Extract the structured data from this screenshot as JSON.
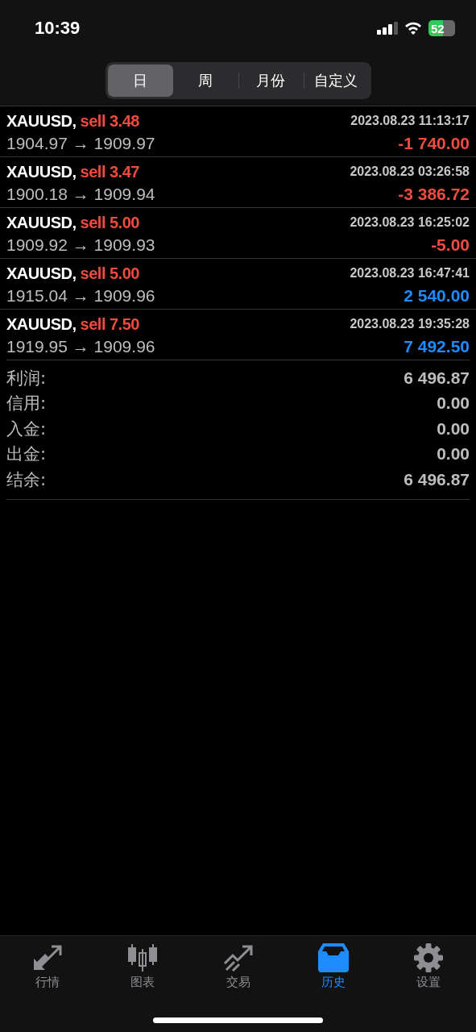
{
  "status_bar": {
    "time": "10:39",
    "battery": "52"
  },
  "tabs": [
    {
      "label": "日",
      "selected": true
    },
    {
      "label": "周",
      "selected": false
    },
    {
      "label": "月份",
      "selected": false
    },
    {
      "label": "自定义",
      "selected": false
    }
  ],
  "trades": [
    {
      "symbol": "XAUUSD,",
      "order": "sell 3.48",
      "time": "2023.08.23 11:13:17",
      "prices": "1904.97 → 1909.97",
      "profit": "-1 740.00",
      "kind": "loss"
    },
    {
      "symbol": "XAUUSD,",
      "order": "sell 3.47",
      "time": "2023.08.23 03:26:58",
      "prices": "1900.18 → 1909.94",
      "profit": "-3 386.72",
      "kind": "loss"
    },
    {
      "symbol": "XAUUSD,",
      "order": "sell 5.00",
      "time": "2023.08.23 16:25:02",
      "prices": "1909.92 → 1909.93",
      "profit": "-5.00",
      "kind": "loss"
    },
    {
      "symbol": "XAUUSD,",
      "order": "sell 5.00",
      "time": "2023.08.23 16:47:41",
      "prices": "1915.04 → 1909.96",
      "profit": "2 540.00",
      "kind": "gain"
    },
    {
      "symbol": "XAUUSD,",
      "order": "sell 7.50",
      "time": "2023.08.23 19:35:28",
      "prices": "1919.95 → 1909.96",
      "profit": "7 492.50",
      "kind": "gain"
    }
  ],
  "summary": [
    {
      "label": "利润:",
      "value": "6 496.87"
    },
    {
      "label": "信用:",
      "value": "0.00"
    },
    {
      "label": "入金:",
      "value": "0.00"
    },
    {
      "label": "出金:",
      "value": "0.00"
    },
    {
      "label": "结余:",
      "value": "6 496.87"
    }
  ],
  "nav": [
    {
      "label": "行情",
      "kind": "quotes",
      "selected": false
    },
    {
      "label": "图表",
      "kind": "chart",
      "selected": false
    },
    {
      "label": "交易",
      "kind": "trade",
      "selected": false
    },
    {
      "label": "历史",
      "kind": "history",
      "selected": true
    },
    {
      "label": "设置",
      "kind": "settings",
      "selected": false
    }
  ]
}
